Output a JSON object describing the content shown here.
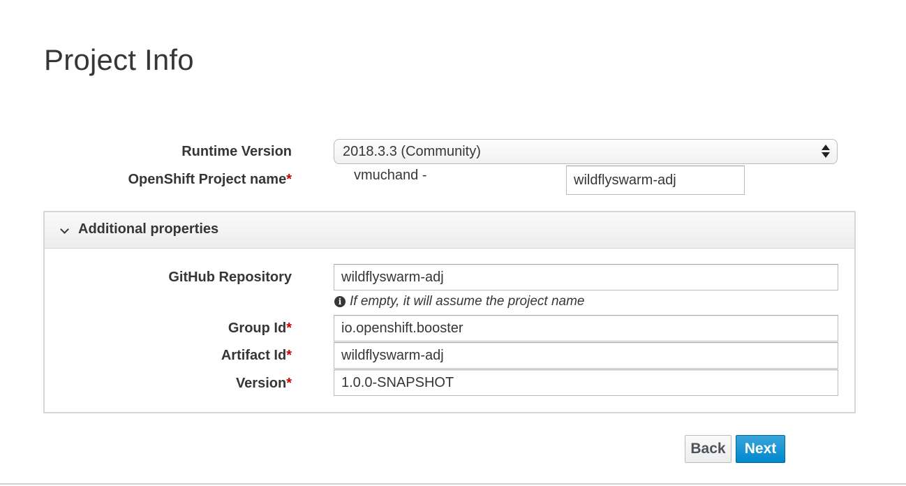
{
  "page_title": "Project Info",
  "form": {
    "runtime_version": {
      "label": "Runtime Version",
      "selected": "2018.3.3 (Community)"
    },
    "openshift_project": {
      "label": "OpenShift Project name",
      "required_marker": "*",
      "prefix": "vmuchand -",
      "value": "wildflyswarm-adj"
    }
  },
  "panel": {
    "title": "Additional properties",
    "expanded": true,
    "github_repo": {
      "label": "GitHub Repository",
      "value": "wildflyswarm-adj",
      "help": "If empty, it will assume the project name",
      "help_icon": "info-icon"
    },
    "group_id": {
      "label": "Group Id",
      "required_marker": "*",
      "value": "io.openshift.booster"
    },
    "artifact_id": {
      "label": "Artifact Id",
      "required_marker": "*",
      "value": "wildflyswarm-adj"
    },
    "version": {
      "label": "Version",
      "required_marker": "*",
      "value": "1.0.0-SNAPSHOT"
    }
  },
  "buttons": {
    "back": "Back",
    "next": "Next"
  },
  "colors": {
    "primary": "#0088ce",
    "required": "#cc0000",
    "text": "#363636"
  }
}
